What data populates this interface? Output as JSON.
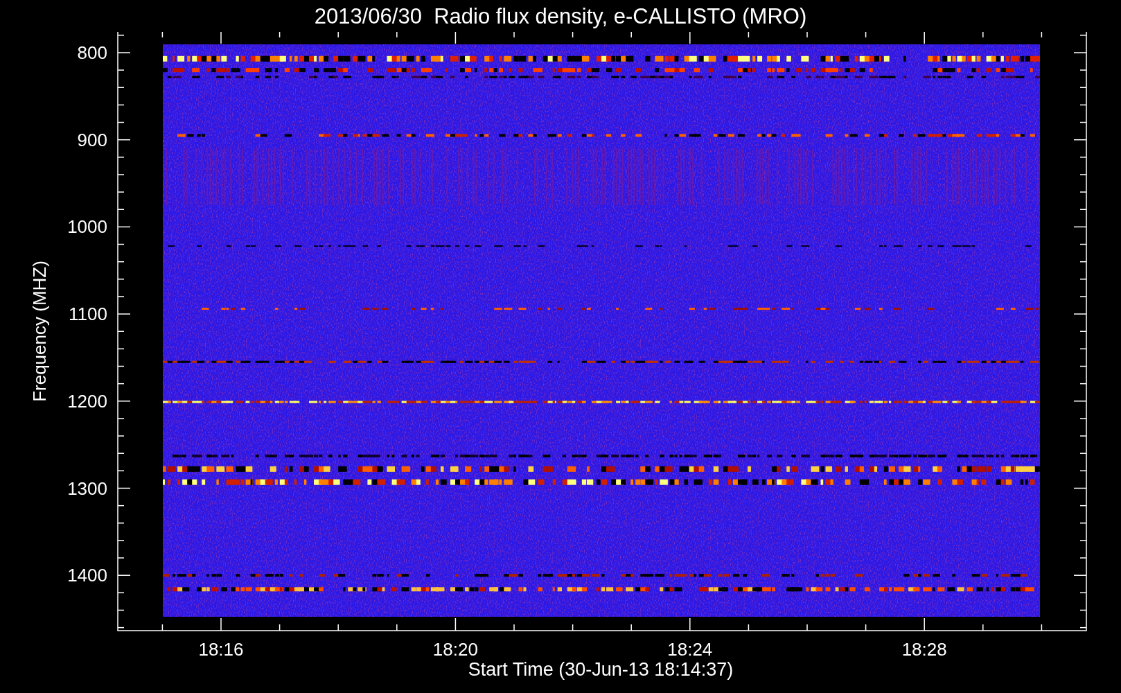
{
  "plot": {
    "title": "2013/06/30  Radio flux density, e-CALLISTO (MRO)",
    "ylabel": "Frequency (MHZ)",
    "xlabel": "Start Time (30-Jun-13 18:14:37)",
    "y_tick_labels": [
      "800",
      "900",
      "1000",
      "1100",
      "1200",
      "1300",
      "1400"
    ],
    "x_tick_labels": [
      "18:16",
      "18:20",
      "18:24",
      "18:28"
    ]
  }
}
